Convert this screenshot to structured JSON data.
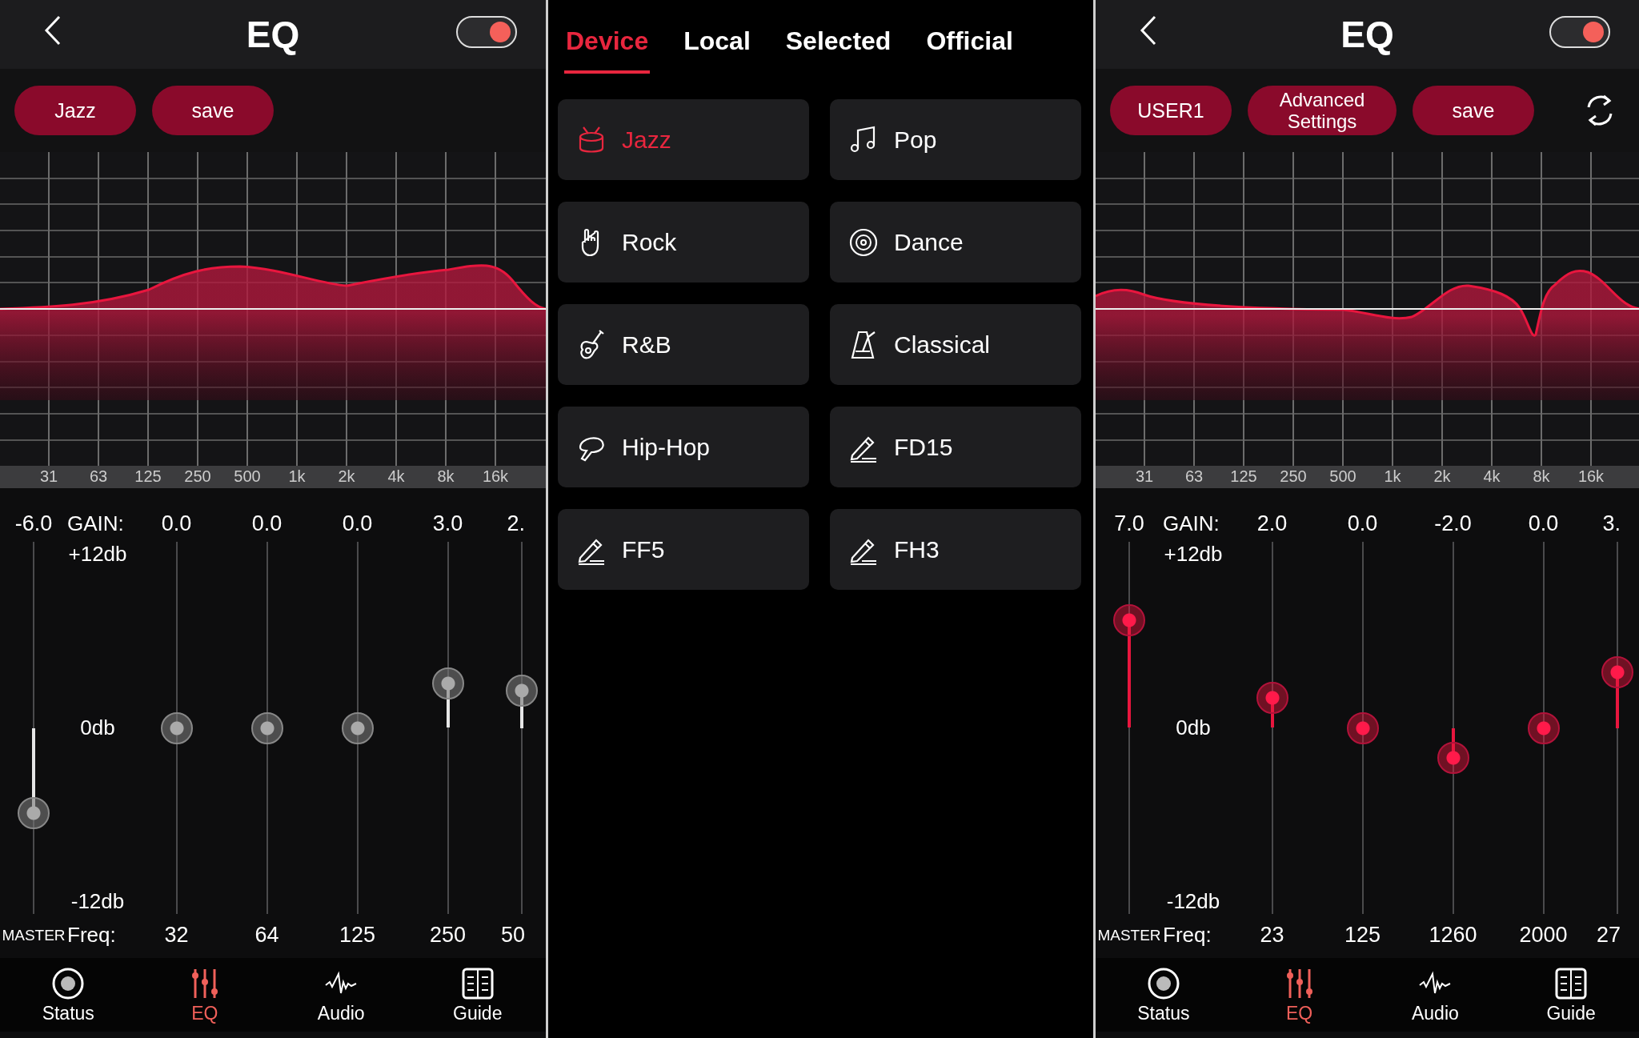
{
  "panels": [
    {
      "kind": "eq",
      "header": {
        "title": "EQ",
        "on": true
      },
      "buttons": [
        {
          "label": "Jazz"
        },
        {
          "label": "save"
        }
      ],
      "frequency_labels": [
        "31",
        "63",
        "125",
        "250",
        "500",
        "1k",
        "2k",
        "4k",
        "8k",
        "16k"
      ],
      "sliders": {
        "disabled": true,
        "gain_label": "GAIN:",
        "top_label": "+12db",
        "zero_label": "0db",
        "bottom_label": "-12db",
        "master_label": "MASTER",
        "freq_label": "Freq:",
        "master": {
          "value": "-6.0",
          "level": 0.27
        },
        "bands": [
          {
            "gain": "0.0",
            "freq": "32",
            "level": 0.5
          },
          {
            "gain": "0.0",
            "freq": "64",
            "level": 0.5
          },
          {
            "gain": "0.0",
            "freq": "125",
            "level": 0.5
          },
          {
            "gain": "3.0",
            "freq": "250",
            "level": 0.62
          },
          {
            "gain": "2.",
            "freq": "50",
            "level": 0.6
          }
        ]
      },
      "nav": [
        {
          "label": "Status",
          "selected": false
        },
        {
          "label": "EQ",
          "selected": true
        },
        {
          "label": "Audio",
          "selected": false
        },
        {
          "label": "Guide",
          "selected": false
        }
      ]
    },
    {
      "kind": "presets",
      "tabs": [
        {
          "label": "Device",
          "selected": true
        },
        {
          "label": "Local",
          "selected": false
        },
        {
          "label": "Selected",
          "selected": false
        },
        {
          "label": "Official",
          "selected": false
        }
      ],
      "presets": [
        {
          "label": "Jazz",
          "kind": "builtin",
          "selected": true
        },
        {
          "label": "Pop",
          "kind": "builtin",
          "selected": false
        },
        {
          "label": "Rock",
          "kind": "builtin",
          "selected": false
        },
        {
          "label": "Dance",
          "kind": "builtin",
          "selected": false
        },
        {
          "label": "R&B",
          "kind": "builtin",
          "selected": false
        },
        {
          "label": "Classical",
          "kind": "builtin",
          "selected": false
        },
        {
          "label": "Hip-Hop",
          "kind": "builtin",
          "selected": false
        },
        {
          "label": "FD15",
          "kind": "custom",
          "selected": false
        },
        {
          "label": "FF5",
          "kind": "custom",
          "selected": false
        },
        {
          "label": "FH3",
          "kind": "custom",
          "selected": false
        }
      ]
    },
    {
      "kind": "eq",
      "header": {
        "title": "EQ",
        "on": true
      },
      "buttons": [
        {
          "label": "USER1"
        },
        {
          "label": "Advanced Settings"
        },
        {
          "label": "save"
        }
      ],
      "reset_icon": true,
      "frequency_labels": [
        "31",
        "63",
        "125",
        "250",
        "500",
        "1k",
        "2k",
        "4k",
        "8k",
        "16k"
      ],
      "sliders": {
        "disabled": false,
        "gain_label": "GAIN:",
        "top_label": "+12db",
        "zero_label": "0db",
        "bottom_label": "-12db",
        "master_label": "MASTER",
        "freq_label": "Freq:",
        "master": {
          "value": "7.0",
          "level": 0.79
        },
        "bands": [
          {
            "gain": "2.0",
            "freq": "23",
            "level": 0.58
          },
          {
            "gain": "0.0",
            "freq": "125",
            "level": 0.5
          },
          {
            "gain": "-2.0",
            "freq": "1260",
            "level": 0.42
          },
          {
            "gain": "0.0",
            "freq": "2000",
            "level": 0.5
          },
          {
            "gain": "3.",
            "freq": "27",
            "level": 0.65
          }
        ]
      },
      "nav": [
        {
          "label": "Status",
          "selected": false
        },
        {
          "label": "EQ",
          "selected": true
        },
        {
          "label": "Audio",
          "selected": false
        },
        {
          "label": "Guide",
          "selected": false
        }
      ]
    }
  ]
}
